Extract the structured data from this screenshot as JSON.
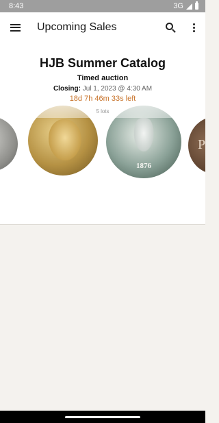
{
  "status_bar": {
    "time": "8:43",
    "network": "3G",
    "signal_icon": "signal-icon",
    "battery_icon": "battery-icon"
  },
  "app_bar": {
    "title": "Upcoming Sales",
    "menu_icon": "hamburger-menu-icon",
    "search_icon": "search-icon",
    "overflow_icon": "more-vert-icon"
  },
  "sale": {
    "title": "HJB Summer Catalog",
    "type": "Timed auction",
    "closing_label": "Closing:",
    "closing_value": "Jul 1, 2023 @ 4:30 AM",
    "countdown": "18d 7h 46m 33s left",
    "lot_count": "5 lots",
    "countdown_color": "#c8732a",
    "coins": [
      {
        "name": "silver coin"
      },
      {
        "name": "gold portrait coin"
      },
      {
        "name": "seated liberty quarter",
        "year": "1876"
      },
      {
        "name": "bronze coin",
        "letter": "P"
      }
    ]
  }
}
